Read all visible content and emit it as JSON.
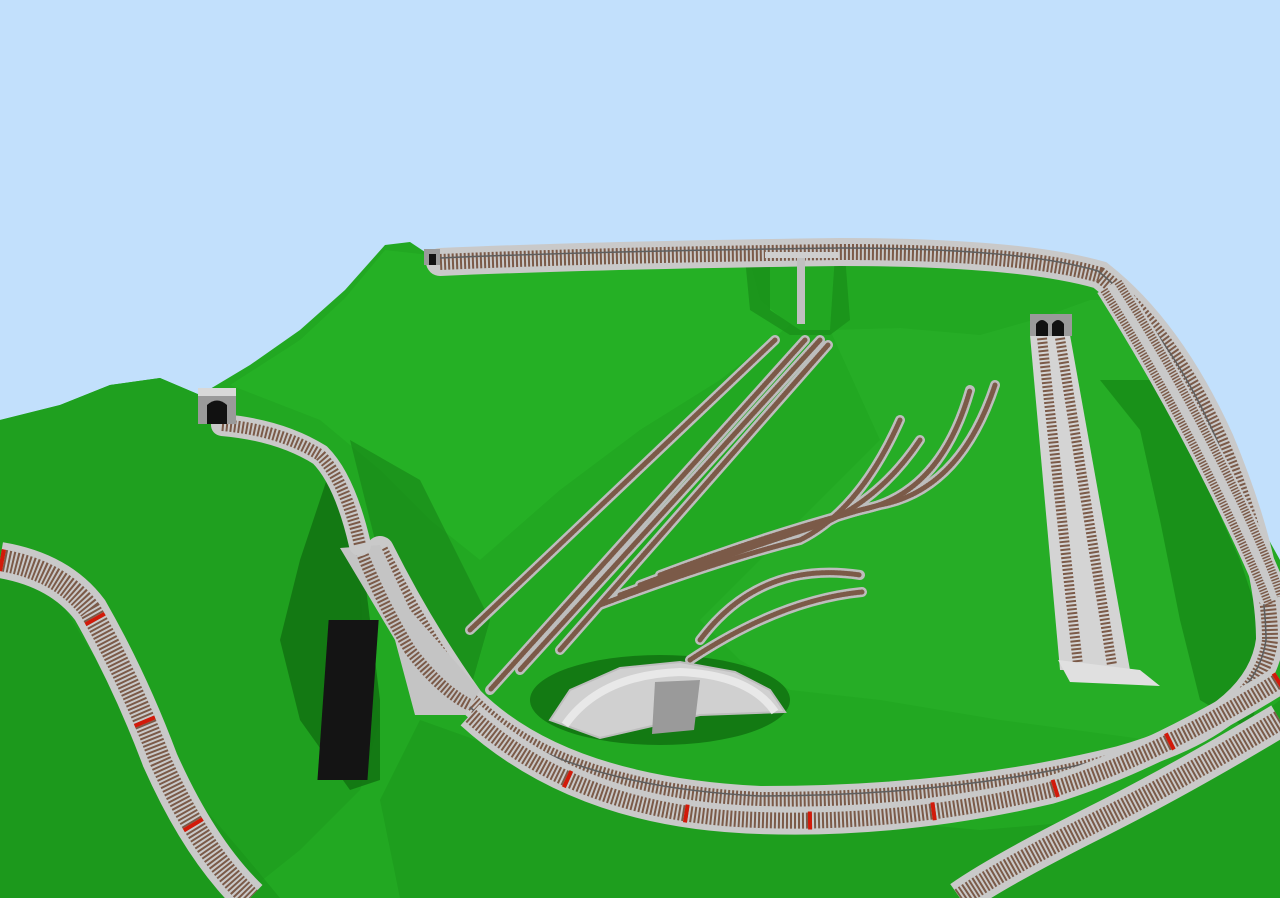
{
  "scene": {
    "kind": "3d-layout-view",
    "colors": {
      "sky": "#c2e0fc",
      "terrain": "#22a822",
      "terrain_dark": "#188a18",
      "terrain_shadow": "#0f6a0f",
      "ballast": "#a4a4a4",
      "ballast_edge": "#d4d4d4",
      "ties": "#7b5a48",
      "rail": "#6e6e6e",
      "marker": "#d21a0a",
      "concrete": "#c8c8c8",
      "pillar": "#141414",
      "tunnel_portal": "#9a9a9a"
    },
    "objects": [
      "terrain",
      "left-hill",
      "back-ridge",
      "main-loop-track",
      "left-descending-track",
      "viaduct",
      "viaduct-pillar",
      "yard-tracks",
      "turntable",
      "right-parallel-tracks",
      "right-double-track",
      "front-right-track",
      "tunnel-portal-left",
      "tunnel-portal-back",
      "tunnel-portal-right-double",
      "bridge-back"
    ]
  }
}
